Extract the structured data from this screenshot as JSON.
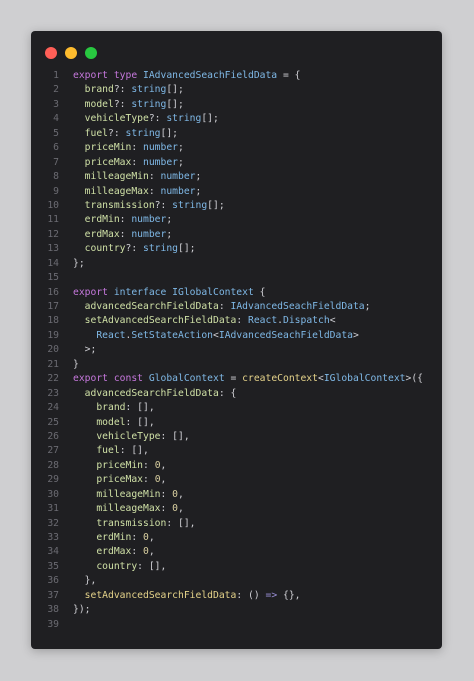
{
  "window": {
    "buttons": {
      "close_color": "#ff5f57",
      "minimize_color": "#febc2e",
      "maximize_color": "#28c840"
    }
  },
  "editor": {
    "theme": {
      "kw": "#c678dd",
      "ty": "#7fb8e6",
      "pn": "#cfcfd4",
      "pr": "#cfe0a6",
      "nm": "#d9cfa0",
      "fn": "#e5d38a",
      "op": "#9a8fd6",
      "pl": "#d4d4d8"
    },
    "lines": [
      {
        "n": "1",
        "tokens": [
          [
            "kw",
            "export type "
          ],
          [
            "ty",
            "IAdvancedSeachFieldData"
          ],
          [
            "pn",
            " = {"
          ]
        ]
      },
      {
        "n": "2",
        "tokens": [
          [
            "pl",
            "  "
          ],
          [
            "pr",
            "brand"
          ],
          [
            "pn",
            "?: "
          ],
          [
            "ty",
            "string"
          ],
          [
            "pn",
            "[];"
          ]
        ]
      },
      {
        "n": "3",
        "tokens": [
          [
            "pl",
            "  "
          ],
          [
            "pr",
            "model"
          ],
          [
            "pn",
            "?: "
          ],
          [
            "ty",
            "string"
          ],
          [
            "pn",
            "[];"
          ]
        ]
      },
      {
        "n": "4",
        "tokens": [
          [
            "pl",
            "  "
          ],
          [
            "pr",
            "vehicleType"
          ],
          [
            "pn",
            "?: "
          ],
          [
            "ty",
            "string"
          ],
          [
            "pn",
            "[];"
          ]
        ]
      },
      {
        "n": "5",
        "tokens": [
          [
            "pl",
            "  "
          ],
          [
            "pr",
            "fuel"
          ],
          [
            "pn",
            "?: "
          ],
          [
            "ty",
            "string"
          ],
          [
            "pn",
            "[];"
          ]
        ]
      },
      {
        "n": "6",
        "tokens": [
          [
            "pl",
            "  "
          ],
          [
            "pr",
            "priceMin"
          ],
          [
            "pn",
            ": "
          ],
          [
            "ty",
            "number"
          ],
          [
            "pn",
            ";"
          ]
        ]
      },
      {
        "n": "7",
        "tokens": [
          [
            "pl",
            "  "
          ],
          [
            "pr",
            "priceMax"
          ],
          [
            "pn",
            ": "
          ],
          [
            "ty",
            "number"
          ],
          [
            "pn",
            ";"
          ]
        ]
      },
      {
        "n": "8",
        "tokens": [
          [
            "pl",
            "  "
          ],
          [
            "pr",
            "milleageMin"
          ],
          [
            "pn",
            ": "
          ],
          [
            "ty",
            "number"
          ],
          [
            "pn",
            ";"
          ]
        ]
      },
      {
        "n": "9",
        "tokens": [
          [
            "pl",
            "  "
          ],
          [
            "pr",
            "milleageMax"
          ],
          [
            "pn",
            ": "
          ],
          [
            "ty",
            "number"
          ],
          [
            "pn",
            ";"
          ]
        ]
      },
      {
        "n": "10",
        "tokens": [
          [
            "pl",
            "  "
          ],
          [
            "pr",
            "transmission"
          ],
          [
            "pn",
            "?: "
          ],
          [
            "ty",
            "string"
          ],
          [
            "pn",
            "[];"
          ]
        ]
      },
      {
        "n": "11",
        "tokens": [
          [
            "pl",
            "  "
          ],
          [
            "pr",
            "erdMin"
          ],
          [
            "pn",
            ": "
          ],
          [
            "ty",
            "number"
          ],
          [
            "pn",
            ";"
          ]
        ]
      },
      {
        "n": "12",
        "tokens": [
          [
            "pl",
            "  "
          ],
          [
            "pr",
            "erdMax"
          ],
          [
            "pn",
            ": "
          ],
          [
            "ty",
            "number"
          ],
          [
            "pn",
            ";"
          ]
        ]
      },
      {
        "n": "13",
        "tokens": [
          [
            "pl",
            "  "
          ],
          [
            "pr",
            "country"
          ],
          [
            "pn",
            "?: "
          ],
          [
            "ty",
            "string"
          ],
          [
            "pn",
            "[];"
          ]
        ]
      },
      {
        "n": "14",
        "tokens": [
          [
            "pn",
            "};"
          ]
        ]
      },
      {
        "n": "15",
        "tokens": []
      },
      {
        "n": "16",
        "tokens": [
          [
            "kw",
            "export "
          ],
          [
            "ty",
            "interface "
          ],
          [
            "ty",
            "IGlobalContext"
          ],
          [
            "pn",
            " {"
          ]
        ]
      },
      {
        "n": "17",
        "tokens": [
          [
            "pl",
            "  "
          ],
          [
            "pr",
            "advancedSearchFieldData"
          ],
          [
            "pn",
            ": "
          ],
          [
            "ty",
            "IAdvancedSeachFieldData"
          ],
          [
            "pn",
            ";"
          ]
        ]
      },
      {
        "n": "18",
        "tokens": [
          [
            "pl",
            "  "
          ],
          [
            "pr",
            "setAdvancedSearchFieldData"
          ],
          [
            "pn",
            ": "
          ],
          [
            "ty",
            "React"
          ],
          [
            "pn",
            "."
          ],
          [
            "ty",
            "Dispatch"
          ],
          [
            "pn",
            "<"
          ]
        ]
      },
      {
        "n": "19",
        "tokens": [
          [
            "pl",
            "    "
          ],
          [
            "ty",
            "React"
          ],
          [
            "pn",
            "."
          ],
          [
            "ty",
            "SetStateAction"
          ],
          [
            "pn",
            "<"
          ],
          [
            "ty",
            "IAdvancedSeachFieldData"
          ],
          [
            "pn",
            ">"
          ]
        ]
      },
      {
        "n": "20",
        "tokens": [
          [
            "pl",
            "  "
          ],
          [
            "pn",
            ">;"
          ]
        ]
      },
      {
        "n": "21",
        "tokens": [
          [
            "pn",
            "}"
          ]
        ]
      },
      {
        "n": "22",
        "tokens": [
          [
            "kw",
            "export const "
          ],
          [
            "ty",
            "GlobalContext"
          ],
          [
            "pn",
            " = "
          ],
          [
            "fn",
            "createContext"
          ],
          [
            "pn",
            "<"
          ],
          [
            "ty",
            "IGlobalContext"
          ],
          [
            "pn",
            ">({"
          ]
        ]
      },
      {
        "n": "23",
        "tokens": [
          [
            "pl",
            "  "
          ],
          [
            "pr",
            "advancedSearchFieldData"
          ],
          [
            "pn",
            ": {"
          ]
        ]
      },
      {
        "n": "24",
        "tokens": [
          [
            "pl",
            "    "
          ],
          [
            "pr",
            "brand"
          ],
          [
            "pn",
            ": [],"
          ]
        ]
      },
      {
        "n": "25",
        "tokens": [
          [
            "pl",
            "    "
          ],
          [
            "pr",
            "model"
          ],
          [
            "pn",
            ": [],"
          ]
        ]
      },
      {
        "n": "26",
        "tokens": [
          [
            "pl",
            "    "
          ],
          [
            "pr",
            "vehicleType"
          ],
          [
            "pn",
            ": [],"
          ]
        ]
      },
      {
        "n": "27",
        "tokens": [
          [
            "pl",
            "    "
          ],
          [
            "pr",
            "fuel"
          ],
          [
            "pn",
            ": [],"
          ]
        ]
      },
      {
        "n": "28",
        "tokens": [
          [
            "pl",
            "    "
          ],
          [
            "pr",
            "priceMin"
          ],
          [
            "pn",
            ": "
          ],
          [
            "nm",
            "0"
          ],
          [
            "pn",
            ","
          ]
        ]
      },
      {
        "n": "29",
        "tokens": [
          [
            "pl",
            "    "
          ],
          [
            "pr",
            "priceMax"
          ],
          [
            "pn",
            ": "
          ],
          [
            "nm",
            "0"
          ],
          [
            "pn",
            ","
          ]
        ]
      },
      {
        "n": "30",
        "tokens": [
          [
            "pl",
            "    "
          ],
          [
            "pr",
            "milleageMin"
          ],
          [
            "pn",
            ": "
          ],
          [
            "nm",
            "0"
          ],
          [
            "pn",
            ","
          ]
        ]
      },
      {
        "n": "31",
        "tokens": [
          [
            "pl",
            "    "
          ],
          [
            "pr",
            "milleageMax"
          ],
          [
            "pn",
            ": "
          ],
          [
            "nm",
            "0"
          ],
          [
            "pn",
            ","
          ]
        ]
      },
      {
        "n": "32",
        "tokens": [
          [
            "pl",
            "    "
          ],
          [
            "pr",
            "transmission"
          ],
          [
            "pn",
            ": [],"
          ]
        ]
      },
      {
        "n": "33",
        "tokens": [
          [
            "pl",
            "    "
          ],
          [
            "pr",
            "erdMin"
          ],
          [
            "pn",
            ": "
          ],
          [
            "nm",
            "0"
          ],
          [
            "pn",
            ","
          ]
        ]
      },
      {
        "n": "34",
        "tokens": [
          [
            "pl",
            "    "
          ],
          [
            "pr",
            "erdMax"
          ],
          [
            "pn",
            ": "
          ],
          [
            "nm",
            "0"
          ],
          [
            "pn",
            ","
          ]
        ]
      },
      {
        "n": "35",
        "tokens": [
          [
            "pl",
            "    "
          ],
          [
            "pr",
            "country"
          ],
          [
            "pn",
            ": [],"
          ]
        ]
      },
      {
        "n": "36",
        "tokens": [
          [
            "pl",
            "  "
          ],
          [
            "pn",
            "},"
          ]
        ]
      },
      {
        "n": "37",
        "tokens": [
          [
            "pl",
            "  "
          ],
          [
            "fn",
            "setAdvancedSearchFieldData"
          ],
          [
            "pn",
            ": () "
          ],
          [
            "op",
            "=>"
          ],
          [
            "pn",
            " {},"
          ]
        ]
      },
      {
        "n": "38",
        "tokens": [
          [
            "pn",
            "});"
          ]
        ]
      },
      {
        "n": "39",
        "tokens": []
      }
    ]
  }
}
